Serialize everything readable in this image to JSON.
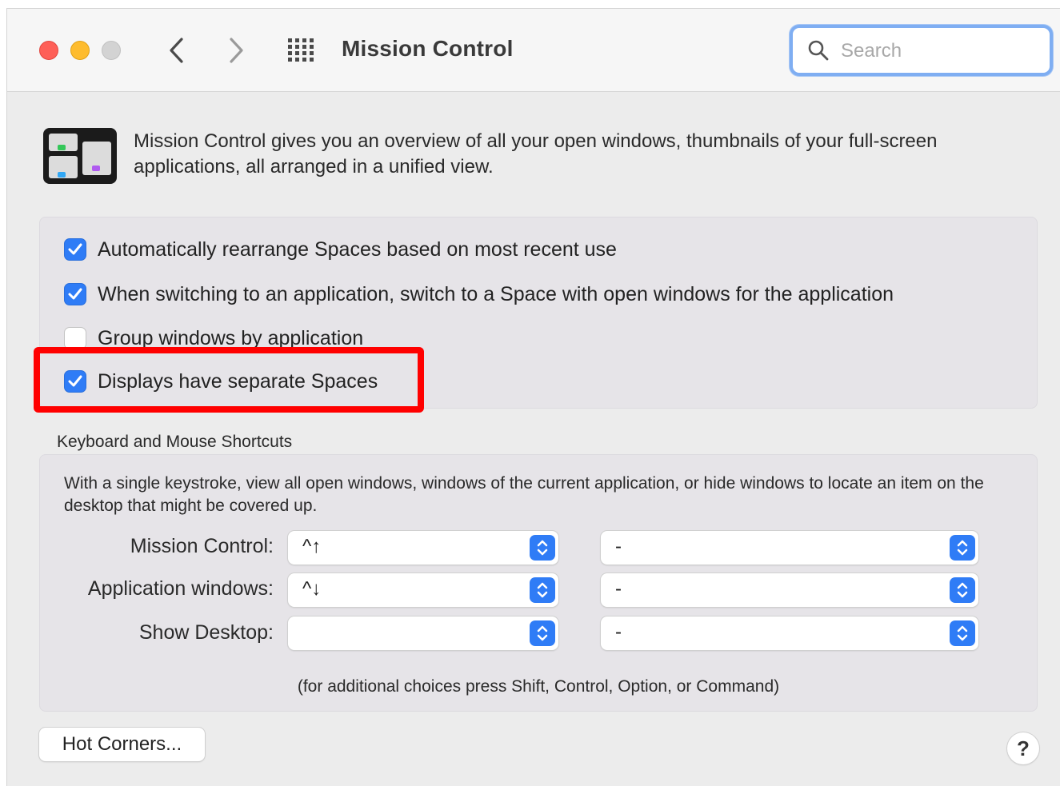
{
  "window": {
    "title": "Mission Control",
    "search": {
      "placeholder": "Search",
      "value": ""
    }
  },
  "description": "Mission Control gives you an overview of all your open windows, thumbnails of your full-screen applications, all arranged in a unified view.",
  "options": [
    {
      "label": "Automatically rearrange Spaces based on most recent use",
      "checked": true
    },
    {
      "label": "When switching to an application, switch to a Space with open windows for the application",
      "checked": true
    },
    {
      "label": "Group windows by application",
      "checked": false
    },
    {
      "label": "Displays have separate Spaces",
      "checked": true
    }
  ],
  "shortcuts": {
    "section_label": "Keyboard and Mouse Shortcuts",
    "description": "With a single keystroke, view all open windows, windows of the current application, or hide windows to locate an item on the desktop that might be covered up.",
    "rows": [
      {
        "label": "Mission Control:",
        "keyboard": "^↑",
        "mouse": "-"
      },
      {
        "label": "Application windows:",
        "keyboard": "^↓",
        "mouse": "-"
      },
      {
        "label": "Show Desktop:",
        "keyboard": "",
        "mouse": "-"
      }
    ],
    "note": "(for additional choices press Shift, Control, Option, or Command)"
  },
  "buttons": {
    "hot_corners": "Hot Corners...",
    "help": "?"
  },
  "colors": {
    "accent": "#2f7cf6",
    "highlight": "#ff0000",
    "close": "#fe5f57",
    "minimize": "#febc2e"
  },
  "icons": [
    "search-icon",
    "back-chevron-icon",
    "forward-chevron-icon",
    "show-all-grid-icon",
    "mission-control-app-icon",
    "checkmark-icon",
    "popup-arrows-icon",
    "help-icon"
  ]
}
